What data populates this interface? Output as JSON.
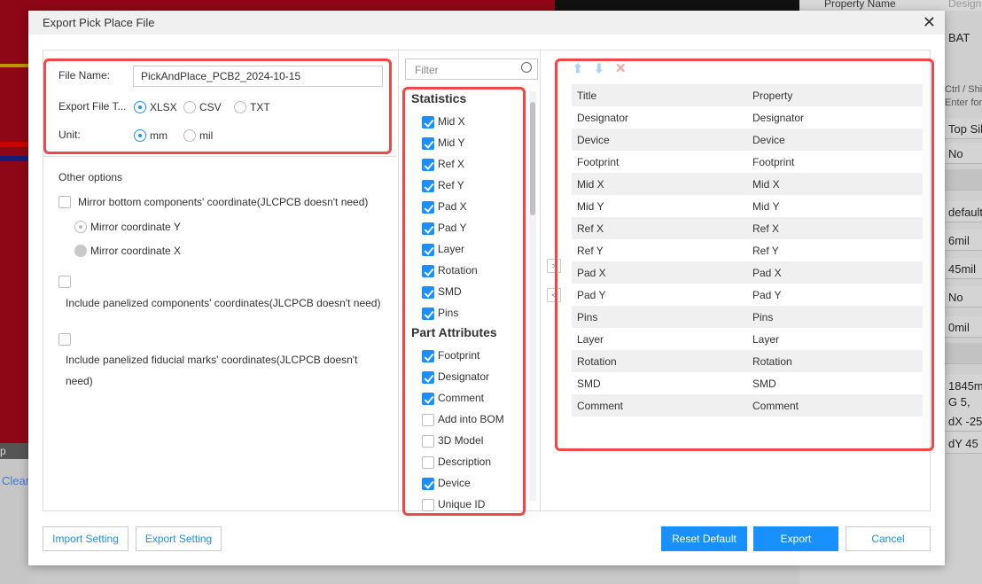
{
  "background": {
    "left_tool_label": "p",
    "clear_link": "Clear",
    "right_panel": {
      "header_col1": "Property Name",
      "header_col2": "Design",
      "cells": [
        "BAT",
        "Ctrl / Shif",
        "Enter for",
        "Top Sil",
        "No",
        "",
        "default",
        "6mil",
        "45mil",
        "No",
        "0mil",
        "",
        "1845m",
        "G  5,",
        "dX  -25",
        "dY  45"
      ]
    }
  },
  "dialog": {
    "title": "Export Pick Place File",
    "close_icon": "close-icon",
    "file_name_label": "File Name:",
    "file_name_value": "PickAndPlace_PCB2_2024-10-15",
    "export_type_label": "Export File T...",
    "export_types": [
      {
        "label": "XLSX",
        "selected": true
      },
      {
        "label": "CSV",
        "selected": false
      },
      {
        "label": "TXT",
        "selected": false
      }
    ],
    "unit_label": "Unit:",
    "units": [
      {
        "label": "mm",
        "selected": true
      },
      {
        "label": "mil",
        "selected": false
      }
    ],
    "other_options": {
      "title": "Other options",
      "mirror_bottom": {
        "label": "Mirror bottom components' coordinate(JLCPCB doesn't need)",
        "checked": false
      },
      "mirror_y": {
        "label": "Mirror coordinate Y",
        "selected": true,
        "disabled": true
      },
      "mirror_x": {
        "label": "Mirror coordinate X",
        "selected": false,
        "disabled": true
      },
      "panelized_components": {
        "label": "Include panelized components' coordinates(JLCPCB doesn't need)",
        "checked": false
      },
      "panelized_fiducial": {
        "label_line1": "Include panelized fiducial marks' coordinates(JLCPCB doesn't",
        "label_line2": "need)",
        "checked": false
      }
    },
    "filter_placeholder": "Filter",
    "groups": [
      {
        "title": "Statistics",
        "items": [
          {
            "label": "Mid X",
            "checked": true
          },
          {
            "label": "Mid Y",
            "checked": true
          },
          {
            "label": "Ref X",
            "checked": true
          },
          {
            "label": "Ref Y",
            "checked": true
          },
          {
            "label": "Pad X",
            "checked": true
          },
          {
            "label": "Pad Y",
            "checked": true
          },
          {
            "label": "Layer",
            "checked": true
          },
          {
            "label": "Rotation",
            "checked": true
          },
          {
            "label": "SMD",
            "checked": true
          },
          {
            "label": "Pins",
            "checked": true
          }
        ]
      },
      {
        "title": "Part Attributes",
        "items": [
          {
            "label": "Footprint",
            "checked": true
          },
          {
            "label": "Designator",
            "checked": true
          },
          {
            "label": "Comment",
            "checked": true
          },
          {
            "label": "Add into BOM",
            "checked": false
          },
          {
            "label": "3D Model",
            "checked": false
          },
          {
            "label": "Description",
            "checked": false
          },
          {
            "label": "Device",
            "checked": true
          },
          {
            "label": "Unique ID",
            "checked": false
          }
        ]
      }
    ],
    "move_right_label": ">",
    "move_left_label": "<",
    "table": {
      "headers": [
        "Title",
        "Property"
      ],
      "rows": [
        [
          "Designator",
          "Designator"
        ],
        [
          "Device",
          "Device"
        ],
        [
          "Footprint",
          "Footprint"
        ],
        [
          "Mid X",
          "Mid X"
        ],
        [
          "Mid Y",
          "Mid Y"
        ],
        [
          "Ref X",
          "Ref X"
        ],
        [
          "Ref Y",
          "Ref Y"
        ],
        [
          "Pad X",
          "Pad X"
        ],
        [
          "Pad Y",
          "Pad Y"
        ],
        [
          "Pins",
          "Pins"
        ],
        [
          "Layer",
          "Layer"
        ],
        [
          "Rotation",
          "Rotation"
        ],
        [
          "SMD",
          "SMD"
        ],
        [
          "Comment",
          "Comment"
        ]
      ]
    },
    "buttons": {
      "import_setting": "Import Setting",
      "export_setting": "Export Setting",
      "reset_default": "Reset Default",
      "export": "Export",
      "cancel": "Cancel"
    },
    "colors": {
      "accent": "#1890ff",
      "highlight": "#f04848"
    }
  }
}
